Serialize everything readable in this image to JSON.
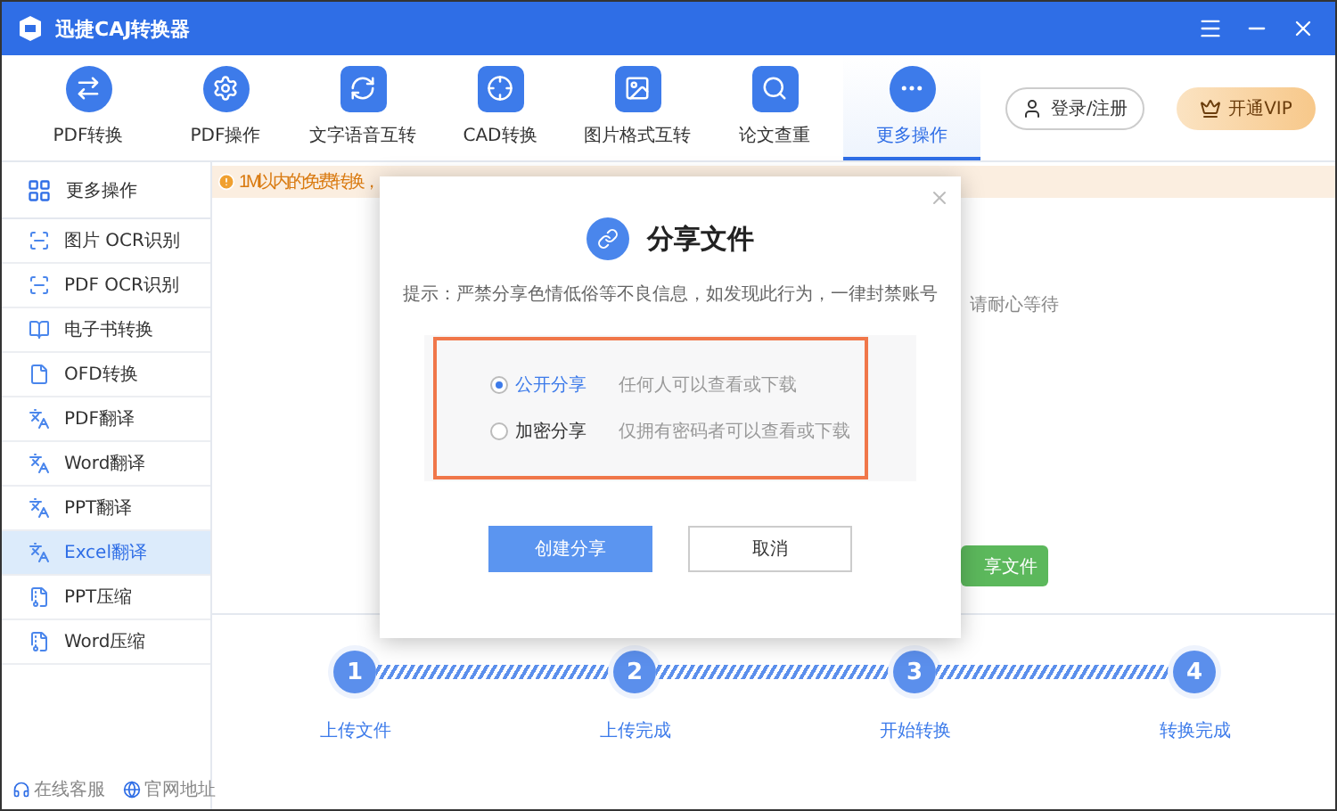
{
  "window": {
    "title": "迅捷CAJ转换器"
  },
  "toolbar": {
    "tabs": [
      {
        "label": "PDF转换",
        "selected": false
      },
      {
        "label": "PDF操作",
        "selected": false
      },
      {
        "label": "文字语音互转",
        "selected": false
      },
      {
        "label": "CAD转换",
        "selected": false
      },
      {
        "label": "图片格式互转",
        "selected": false
      },
      {
        "label": "论文查重",
        "selected": false
      },
      {
        "label": "更多操作",
        "selected": true
      }
    ],
    "login_button": "登录/注册",
    "vip_button": "开通VIP"
  },
  "sidebar": {
    "header": "更多操作",
    "items": [
      {
        "label": "图片 OCR识别",
        "selected": false
      },
      {
        "label": "PDF OCR识别",
        "selected": false
      },
      {
        "label": "电子书转换",
        "selected": false
      },
      {
        "label": "OFD转换",
        "selected": false
      },
      {
        "label": "PDF翻译",
        "selected": false
      },
      {
        "label": "Word翻译",
        "selected": false
      },
      {
        "label": "PPT翻译",
        "selected": false
      },
      {
        "label": "Excel翻译",
        "selected": true
      },
      {
        "label": "PPT压缩",
        "selected": false
      },
      {
        "label": "Word压缩",
        "selected": false
      }
    ],
    "footer_links": [
      "在线客服",
      "官网地址"
    ]
  },
  "notice": "1M以内的免费转换，",
  "background": {
    "status_text": "请耐心等待",
    "action_button": "享文件"
  },
  "steps": [
    {
      "number": "1",
      "label": "上传文件"
    },
    {
      "number": "2",
      "label": "上传完成"
    },
    {
      "number": "3",
      "label": "开始转换"
    },
    {
      "number": "4",
      "label": "转换完成"
    }
  ],
  "dialog": {
    "title": "分享文件",
    "hint": "提示：严禁分享色情低俗等不良信息，如发现此行为，一律封禁账号",
    "options": [
      {
        "label": "公开分享",
        "description": "任何人可以查看或下载",
        "selected": true
      },
      {
        "label": "加密分享",
        "description": "仅拥有密码者可以查看或下载",
        "selected": false
      }
    ],
    "buttons": [
      {
        "label": "创建分享",
        "kind": "primary"
      },
      {
        "label": "取消",
        "kind": "secondary"
      }
    ]
  }
}
